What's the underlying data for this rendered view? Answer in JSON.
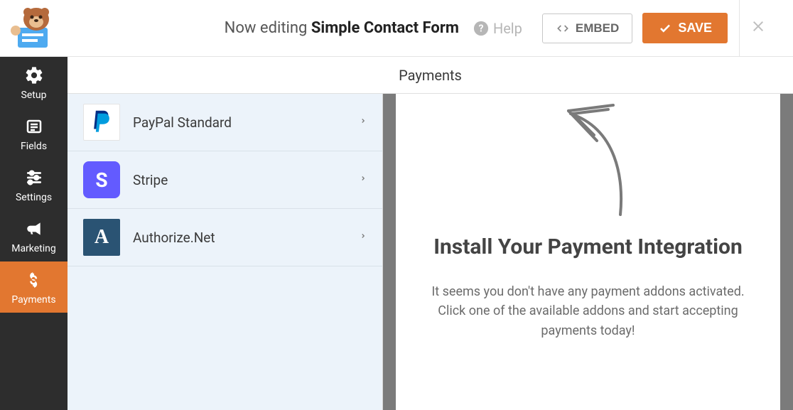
{
  "header": {
    "editing_prefix": "Now editing",
    "form_name": "Simple Contact Form",
    "help_label": "Help",
    "embed_label": "EMBED",
    "save_label": "SAVE"
  },
  "sidenav": {
    "items": [
      {
        "label": "Setup"
      },
      {
        "label": "Fields"
      },
      {
        "label": "Settings"
      },
      {
        "label": "Marketing"
      },
      {
        "label": "Payments"
      }
    ]
  },
  "panel_title": "Payments",
  "providers": [
    {
      "label": "PayPal Standard",
      "icon_key": "paypal"
    },
    {
      "label": "Stripe",
      "icon_key": "stripe"
    },
    {
      "label": "Authorize.Net",
      "icon_key": "authorize"
    }
  ],
  "preview": {
    "heading": "Install Your Payment Integration",
    "description": "It seems you don't have any payment addons activated. Click one of the available addons and start accepting payments today!"
  }
}
